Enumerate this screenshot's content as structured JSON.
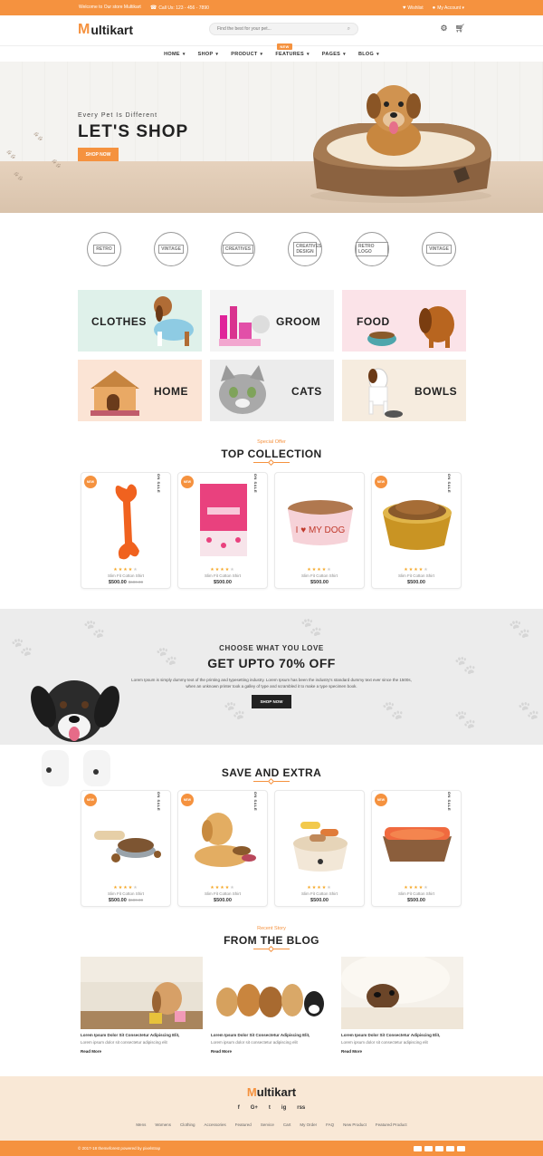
{
  "topbar": {
    "welcome": "Welcome to Our store Multikart",
    "call": "Call Us: 123 - 456 - 7890",
    "wishlist": "Wishlist",
    "account": "My Account"
  },
  "header": {
    "logo_mark": "M",
    "logo_text": "ultikart",
    "search_placeholder": "Find the best for your pet..."
  },
  "nav": {
    "items": [
      "HOME",
      "SHOP",
      "PRODUCT",
      "FEATURES",
      "PAGES",
      "BLOG"
    ],
    "badge": "NEW"
  },
  "hero": {
    "subtitle": "Every Pet Is Different",
    "title": "LET'S SHOP",
    "button": "SHOP NOW"
  },
  "brands": [
    "RETRO",
    "VINTAGE",
    "CREATIVES",
    "CREATIVES DESIGN",
    "RETRO LOGO",
    "VINTAGE"
  ],
  "categories": [
    "CLOTHES",
    "GROOM",
    "FOOD",
    "HOME",
    "CATS",
    "BOWLS"
  ],
  "top_collection": {
    "subtitle": "Special Offer",
    "title": "TOP COLLECTION",
    "products": [
      {
        "badge": "NEW",
        "onsale": "ON SALE",
        "name": "Slim Fit Cotton Shirt",
        "price": "$500.00",
        "old_price": "$600.00"
      },
      {
        "badge": "NEW",
        "onsale": "ON SALE",
        "name": "Slim Fit Cotton Shirt",
        "price": "$500.00",
        "old_price": ""
      },
      {
        "badge": "",
        "onsale": "",
        "name": "Slim Fit Cotton Shirt",
        "price": "$500.00",
        "old_price": ""
      },
      {
        "badge": "NEW",
        "onsale": "ON SALE",
        "name": "Slim Fit Cotton Shirt",
        "price": "$500.00",
        "old_price": ""
      }
    ]
  },
  "promo": {
    "subtitle": "CHOOSE WHAT YOU LOVE",
    "title": "GET UPTO 70% OFF",
    "text": "Lorem Ipsum is simply dummy text of the printing and typesetting industry. Lorem Ipsum has been the industry's standard dummy text ever since the 1500s, when an unknown printer took a galley of type and scrambled it to make a type specimen book.",
    "button": "SHOP NOW"
  },
  "save_extra": {
    "title": "SAVE AND EXTRA",
    "products": [
      {
        "badge": "NEW",
        "onsale": "ON SALE",
        "name": "Slim Fit Cotton Shirt",
        "price": "$500.00",
        "old_price": "$600.00"
      },
      {
        "badge": "NEW",
        "onsale": "ON SALE",
        "name": "Slim Fit Cotton Shirt",
        "price": "$500.00",
        "old_price": ""
      },
      {
        "badge": "",
        "onsale": "",
        "name": "Slim Fit Cotton Shirt",
        "price": "$500.00",
        "old_price": ""
      },
      {
        "badge": "NEW",
        "onsale": "ON SALE",
        "name": "Slim Fit Cotton Shirt",
        "price": "$500.00",
        "old_price": ""
      }
    ]
  },
  "blog": {
    "subtitle": "Recent Story",
    "title": "FROM THE BLOG",
    "posts": [
      {
        "title": "Lorem Ipsum Dolor Sit Consectetur Adipiscing Elit,",
        "text": "Lorem ipsum dolor sit consectetur adipiscing elit",
        "more": "Read More"
      },
      {
        "title": "Lorem Ipsum Dolor Sit Consectetur Adipiscing Elit,",
        "text": "Lorem ipsum dolor sit consectetur adipiscing elit",
        "more": "Read More"
      },
      {
        "title": "Lorem Ipsum Dolor Sit Consectetur Adipiscing Elit,",
        "text": "Lorem ipsum dolor sit consectetur adipiscing elit",
        "more": "Read More"
      }
    ]
  },
  "footer": {
    "logo_mark": "M",
    "logo_text": "ultikart",
    "social": [
      "f",
      "G+",
      "t",
      "ig",
      "rss"
    ],
    "links": [
      "Mens",
      "Womens",
      "Clothing",
      "Accessories",
      "Featured",
      "Service",
      "Cart",
      "My Order",
      "FAQ",
      "New Product",
      "Featured Product"
    ],
    "copyright": "© 2017-18 themeforest powered by pixelstrap"
  },
  "colors": {
    "accent": "#f5923f",
    "dark": "#222222"
  }
}
